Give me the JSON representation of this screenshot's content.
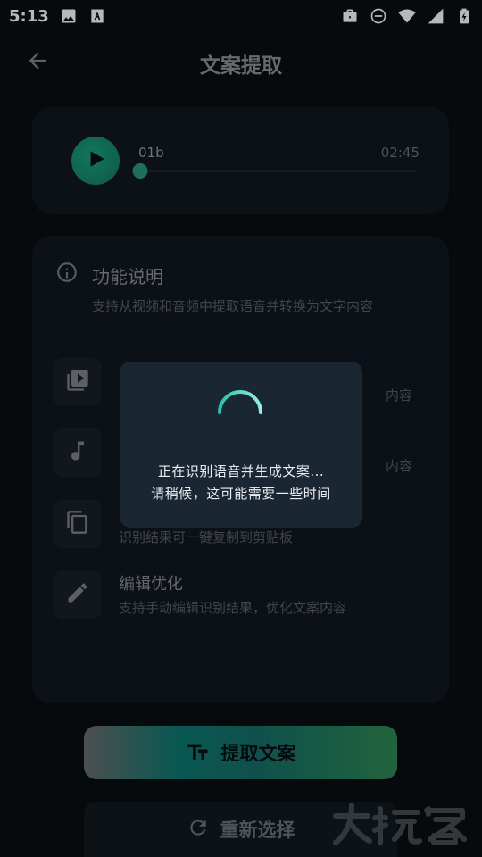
{
  "status_bar": {
    "time": "5:13",
    "left_icons": [
      "image-icon",
      "text-a-icon"
    ],
    "right_icons": [
      "briefcase-icon",
      "do-not-disturb-icon",
      "wifi-icon",
      "signal-icon",
      "battery-charging-icon"
    ]
  },
  "app_bar": {
    "title": "文案提取",
    "back_icon": "back-arrow-icon"
  },
  "player": {
    "track_name": "01b",
    "duration": "02:45",
    "progress_fraction": 0.0,
    "play_icon": "play-icon"
  },
  "info": {
    "title": "功能说明",
    "description": "支持从视频和音频中提取语音并转换为文字内容",
    "features": [
      {
        "icon": "video-library-icon",
        "title": "",
        "desc": "内容"
      },
      {
        "icon": "music-note-icon",
        "title": "",
        "desc": "内容"
      },
      {
        "icon": "copy-icon",
        "title": "",
        "desc": "识别结果可一键复制到剪贴板"
      },
      {
        "icon": "edit-pencil-icon",
        "title": "编辑优化",
        "desc": "支持手动编辑识别结果，优化文案内容"
      }
    ]
  },
  "actions": {
    "extract_label": "提取文案",
    "reselect_label": "重新选择"
  },
  "dialog": {
    "line1": "正在识别语音并生成文案...",
    "line2": "请稍候，这可能需要一些时间"
  },
  "colors": {
    "background": "#0b0f13",
    "card": "#111820",
    "accent": "#2a9c7b",
    "dialog": "#1b2633"
  }
}
